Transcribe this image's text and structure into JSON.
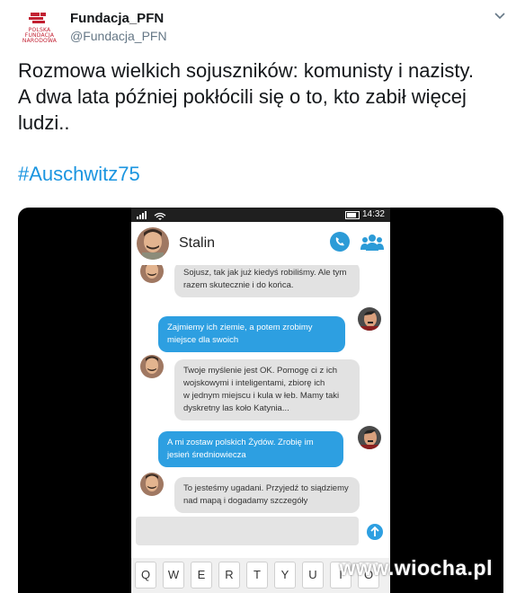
{
  "tweet": {
    "author_name": "Fundacja_PFN",
    "author_handle": "@Fundacja_PFN",
    "logo_text": [
      "POLSKA",
      "FUNDACJA",
      "NARODOWA"
    ],
    "text_lines": [
      "Rozmowa wielkich sojuszników: komunisty i nazisty.",
      "A dwa lata później pokłócili się o to, kto zabił więcej",
      "ludzi.."
    ],
    "hashtag": "#Auschwitz75",
    "menu_icon": "chevron-down-icon",
    "colors": {
      "link": "#1b95e0",
      "handle": "#657786",
      "logo": "#c22032"
    }
  },
  "phone": {
    "status_time": "14:32",
    "contact_name": "Stalin",
    "colors": {
      "out_bubble": "#2d9fe1",
      "in_bubble": "#e2e2e2",
      "call": "#2c9bd7"
    },
    "messages": [
      {
        "from": "in",
        "text": "Sojusz, tak jak już kiedyś robiliśmy. Ale tym\nrazem skutecznie i do końca."
      },
      {
        "from": "out",
        "text": "Zajmiemy ich ziemie, a potem zrobimy\nmiejsce dla swoich"
      },
      {
        "from": "in",
        "text": "Twoje myślenie jest OK. Pomogę ci z ich\nwojskowymi i inteligentami, zbiorę ich\nw jednym miejscu i kula w łeb. Mamy taki\ndyskretny las koło Katynia..."
      },
      {
        "from": "out",
        "text": "A mi zostaw polskich Żydów. Zrobię im\njesień średniowiecza"
      },
      {
        "from": "in",
        "text": "To jesteśmy ugadani. Przyjedź to siądziemy\nnad mapą i dogadamy szczegóły"
      }
    ],
    "keyboard_keys": [
      "Q",
      "W",
      "E",
      "R",
      "T",
      "Y",
      "U",
      "I",
      "O"
    ]
  },
  "watermark": "www.wiocha.pl"
}
